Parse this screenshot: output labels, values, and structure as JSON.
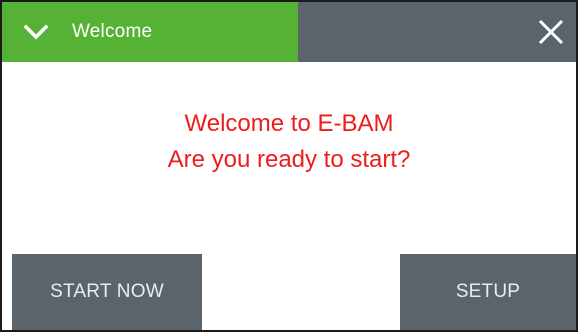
{
  "header": {
    "title": "Welcome",
    "icon_left": "chevron-down-icon",
    "icon_right": "close-icon",
    "tab_color": "#55b234",
    "bar_color": "#5c646b"
  },
  "message": {
    "line1": "Welcome to E-BAM",
    "line2": "Are you ready to start?",
    "color": "#ee1c1c"
  },
  "buttons": {
    "start_label": "START NOW",
    "setup_label": "SETUP",
    "color": "#5c646b"
  }
}
